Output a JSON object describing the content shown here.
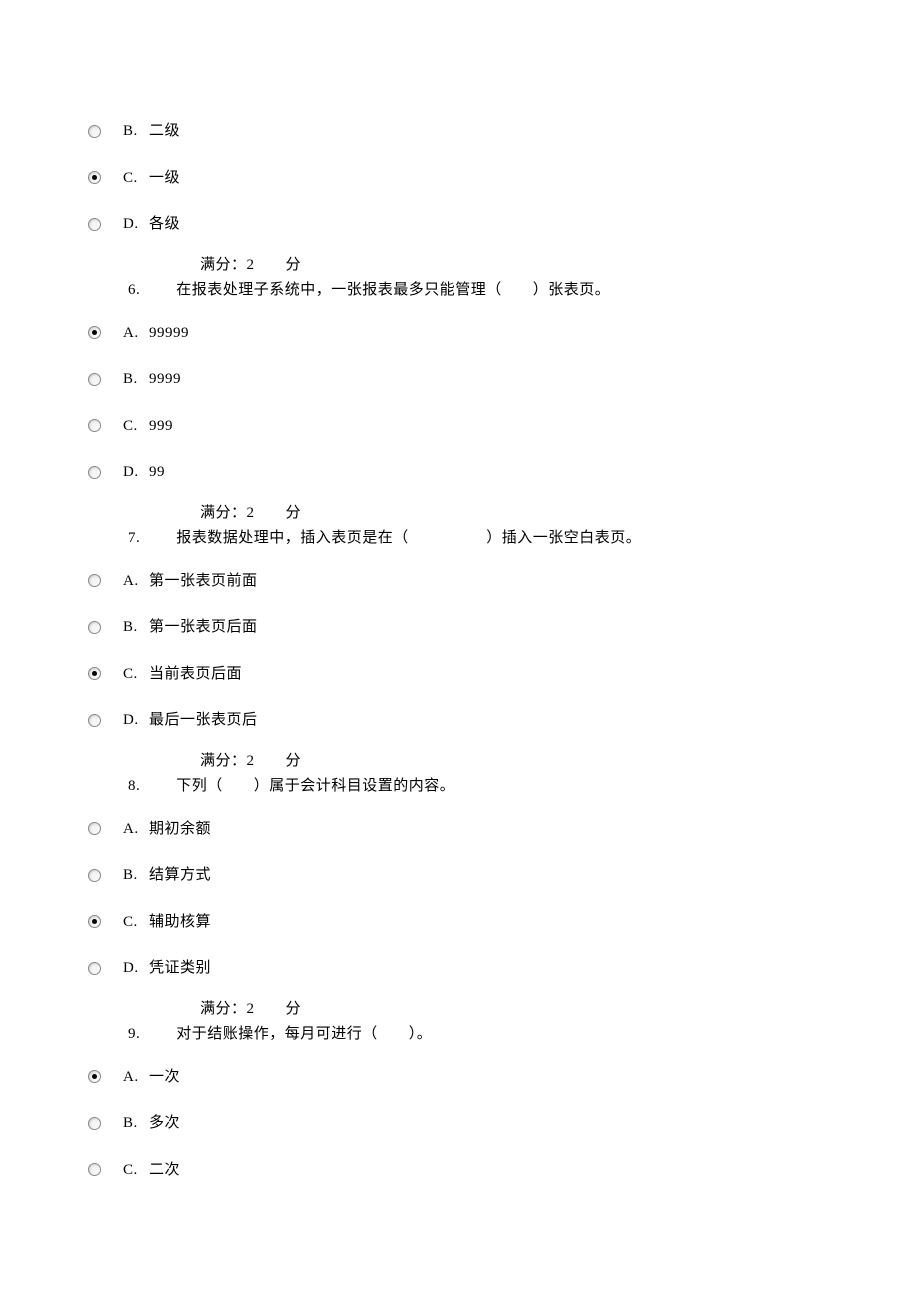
{
  "q5_tail": {
    "options": [
      {
        "letter": "B.",
        "text": "二级",
        "selected": false
      },
      {
        "letter": "C.",
        "text": "一级",
        "selected": true
      },
      {
        "letter": "D.",
        "text": "各级",
        "selected": false
      }
    ]
  },
  "score_label": "满分：2",
  "score_unit": "分",
  "q6": {
    "num": "6.",
    "text": "在报表处理子系统中，一张报表最多只能管理（　　）张表页。",
    "options": [
      {
        "letter": "A.",
        "text": "99999",
        "selected": true
      },
      {
        "letter": "B.",
        "text": "9999",
        "selected": false
      },
      {
        "letter": "C.",
        "text": "999",
        "selected": false
      },
      {
        "letter": "D.",
        "text": "99",
        "selected": false
      }
    ]
  },
  "q7": {
    "num": "7.",
    "text": "报表数据处理中，插入表页是在（　　　　　）插入一张空白表页。",
    "options": [
      {
        "letter": "A.",
        "text": "第一张表页前面",
        "selected": false
      },
      {
        "letter": "B.",
        "text": "第一张表页后面",
        "selected": false
      },
      {
        "letter": "C.",
        "text": "当前表页后面",
        "selected": true
      },
      {
        "letter": "D.",
        "text": "最后一张表页后",
        "selected": false
      }
    ]
  },
  "q8": {
    "num": "8.",
    "text": "下列（　　）属于会计科目设置的内容。",
    "options": [
      {
        "letter": "A.",
        "text": "期初余额",
        "selected": false
      },
      {
        "letter": "B.",
        "text": "结算方式",
        "selected": false
      },
      {
        "letter": "C.",
        "text": "辅助核算",
        "selected": true
      },
      {
        "letter": "D.",
        "text": "凭证类别",
        "selected": false
      }
    ]
  },
  "q9": {
    "num": "9.",
    "text": "对于结账操作，每月可进行（　　）。",
    "options": [
      {
        "letter": "A.",
        "text": "一次",
        "selected": true
      },
      {
        "letter": "B.",
        "text": "多次",
        "selected": false
      },
      {
        "letter": "C.",
        "text": "二次",
        "selected": false
      }
    ]
  }
}
